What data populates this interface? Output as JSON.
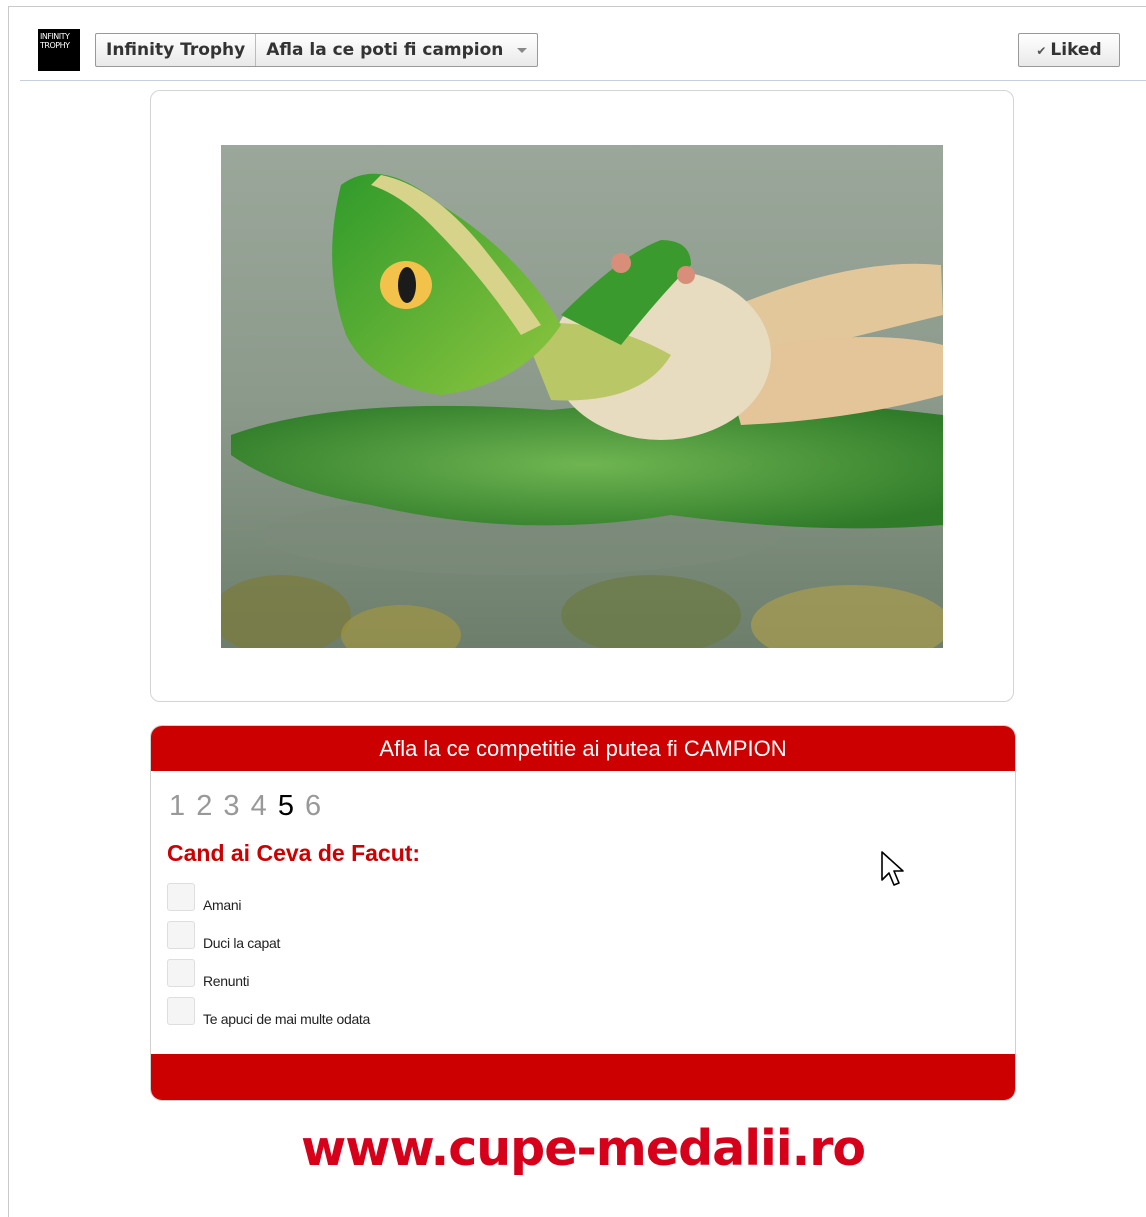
{
  "header": {
    "logo_lines": [
      "INFINITY",
      "TROPHY"
    ],
    "breadcrumb": {
      "page_name": "Infinity Trophy",
      "tab_name": "Afla la ce poti fi campion"
    },
    "liked_label": "Liked"
  },
  "image": {
    "icon": "frog-relaxing-on-lily-pad"
  },
  "quiz": {
    "title": "Afla la ce competitie ai putea fi CAMPION",
    "pages": [
      "1",
      "2",
      "3",
      "4",
      "5",
      "6"
    ],
    "current_page": "5",
    "question": "Cand ai Ceva de Facut:",
    "options": [
      {
        "label": "Amani",
        "checked": false
      },
      {
        "label": "Duci la capat",
        "checked": false
      },
      {
        "label": "Renunti",
        "checked": false
      },
      {
        "label": "Te apuci de mai multe odata",
        "checked": false
      }
    ],
    "accent_color": "#cc0000"
  },
  "footer": {
    "site_url": "www.cupe-medalii.ro"
  }
}
